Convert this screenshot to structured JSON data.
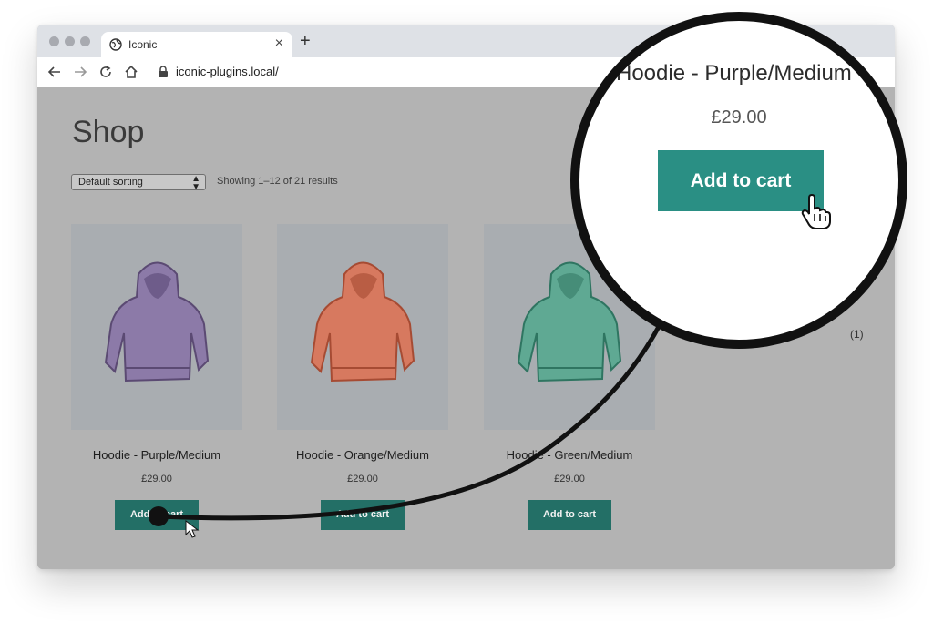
{
  "browser": {
    "tab_title": "Iconic",
    "new_tab_label": "+",
    "close_label": "×",
    "url": "iconic-plugins.local/"
  },
  "page": {
    "title": "Shop",
    "sorting": {
      "selected": "Default sorting"
    },
    "result_count": "Showing 1–12 of 21 results",
    "side_count": "(1)"
  },
  "products": [
    {
      "name": "Hoodie - Purple/Medium",
      "price": "£29.00",
      "button": "Add to cart",
      "color": "#8c7aa8"
    },
    {
      "name": "Hoodie - Orange/Medium",
      "price": "£29.00",
      "button": "Add to cart",
      "color": "#d7795f"
    },
    {
      "name": "Hoodie - Green/Medium",
      "price": "£29.00",
      "button": "Add to cart",
      "color": "#5fa993"
    }
  ],
  "zoom": {
    "name": "Hoodie - Purple/Medium",
    "price": "£29.00",
    "button": "Add to cart"
  },
  "colors": {
    "accent": "#236f66",
    "zoom_accent": "#2a8f84"
  }
}
